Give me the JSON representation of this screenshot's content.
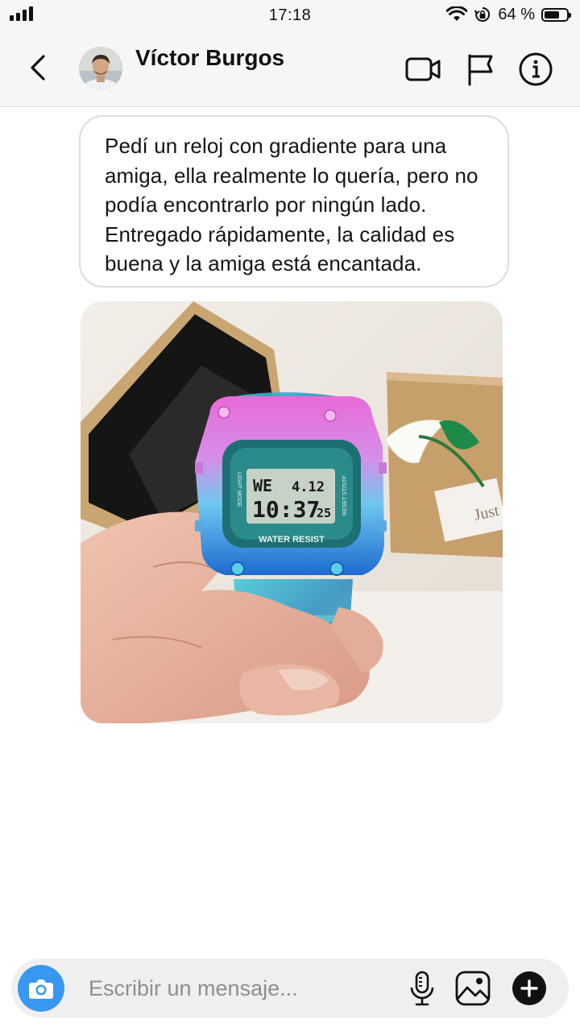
{
  "status_bar": {
    "time": "17:18",
    "battery": "64 %",
    "icons": [
      "signal-icon",
      "wifi-icon",
      "orientation-lock-icon",
      "battery-icon"
    ]
  },
  "header": {
    "contact_name": "Víctor Burgos",
    "icons": [
      "back-icon",
      "video-call-icon",
      "flag-icon",
      "info-icon"
    ]
  },
  "messages": [
    {
      "type": "text",
      "text": "Pedí un reloj con gradiente para una amiga, ella realmente lo quería, pero no podía encontrarlo por ningún lado. Entregado rápidamente, la calidad es buena y la amiga está encantada."
    },
    {
      "type": "photo",
      "watch_text": {
        "day": "WE",
        "date": "4.12",
        "time": "10:37",
        "seconds": "25",
        "label": "WATER RESIST",
        "left_side": "LIGHT MODE",
        "right_side": "RESET ST/STP"
      },
      "box_text": "Just"
    }
  ],
  "composer": {
    "placeholder": "Escribir un mensaje...",
    "icons": [
      "camera-icon",
      "microphone-icon",
      "gallery-icon",
      "plus-icon"
    ]
  },
  "colors": {
    "accent": "#3897f0",
    "header_bg": "#f6f6f6",
    "composer_bg": "#efefef"
  }
}
